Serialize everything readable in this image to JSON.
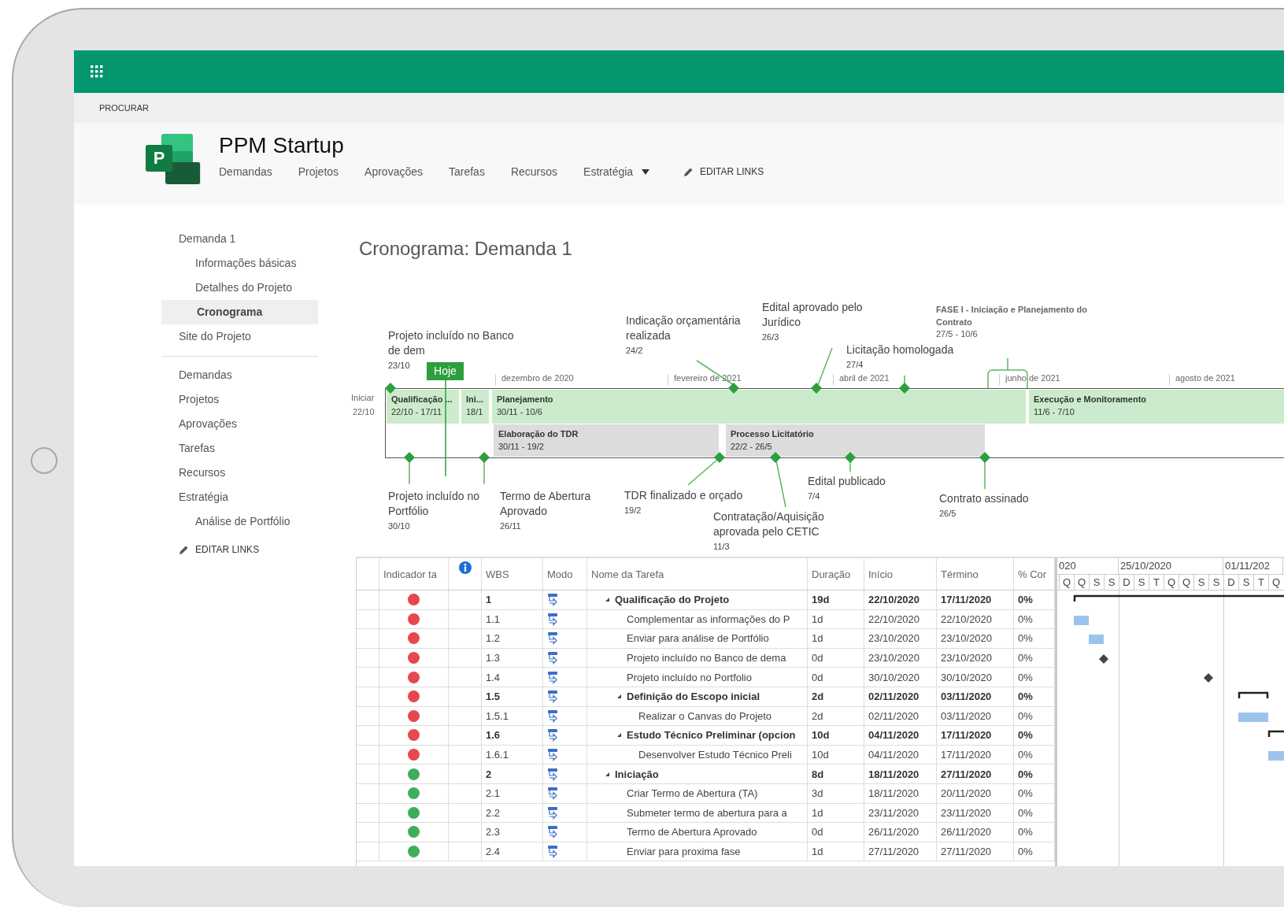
{
  "search_bar": {
    "label": "PROCURAR"
  },
  "site": {
    "logo_letter": "P",
    "title": "PPM Startup",
    "nav": [
      {
        "label": "Demandas",
        "dropdown": false
      },
      {
        "label": "Projetos",
        "dropdown": false
      },
      {
        "label": "Aprovações",
        "dropdown": false
      },
      {
        "label": "Tarefas",
        "dropdown": false
      },
      {
        "label": "Recursos",
        "dropdown": false
      },
      {
        "label": "Estratégia",
        "dropdown": true
      }
    ],
    "edit_links": "EDITAR LINKS"
  },
  "sidebar": {
    "sections": [
      {
        "items": [
          {
            "label": "Demanda 1",
            "selected": false,
            "children": [
              {
                "label": "Informações básicas",
                "selected": false
              },
              {
                "label": "Detalhes do Projeto",
                "selected": false
              },
              {
                "label": "Cronograma",
                "selected": true
              }
            ]
          },
          {
            "label": "Site do Projeto",
            "selected": false
          }
        ]
      },
      {
        "items": [
          {
            "label": "Demandas",
            "selected": false
          },
          {
            "label": "Projetos",
            "selected": false
          },
          {
            "label": "Aprovações",
            "selected": false
          },
          {
            "label": "Tarefas",
            "selected": false
          },
          {
            "label": "Recursos",
            "selected": false
          },
          {
            "label": "Estratégia",
            "selected": false,
            "children": [
              {
                "label": "Análise de Portfólio",
                "selected": false
              }
            ]
          }
        ]
      }
    ],
    "edit_links": "EDITAR LINKS"
  },
  "page_title": "Cronograma: Demanda 1",
  "timeline": {
    "start": {
      "label": "Iniciar",
      "date": "22/10"
    },
    "today": "Hoje",
    "months": [
      "dezembro de 2020",
      "fevereiro de 2021",
      "abril de 2021",
      "junho de 2021",
      "agosto de 2021"
    ],
    "phases": [
      {
        "name": "Qualificação ...",
        "dates": "22/10 - 17/11"
      },
      {
        "name": "Ini...",
        "dates": "18/1"
      },
      {
        "name": "Planejamento",
        "dates": "30/11 - 10/6"
      },
      {
        "name": "Execução e Monitoramento",
        "dates": "11/6 - 7/10"
      }
    ],
    "tasks": [
      {
        "name": "Elaboração do TDR",
        "dates": "30/11 - 19/2"
      },
      {
        "name": "Processo Licitatório",
        "dates": "22/2 - 26/5"
      }
    ],
    "bracket": {
      "label": "FASE I - Iniciação e Planejamento do Contrato",
      "dates": "27/5 - 10/6"
    },
    "milestones_above": [
      {
        "label": "Projeto incluído no Banco de dem",
        "date": "23/10"
      },
      {
        "label": "Indicação orçamentária realizada",
        "date": "24/2"
      },
      {
        "label": "Edital aprovado pelo Jurídico",
        "date": "26/3"
      },
      {
        "label": "Licitação homologada",
        "date": "27/4"
      }
    ],
    "milestones_below": [
      {
        "label": "Projeto incluído no Portfólio",
        "date": "30/10"
      },
      {
        "label": "Termo de Abertura Aprovado",
        "date": "26/11"
      },
      {
        "label": "TDR finalizado e orçado",
        "date": "19/2"
      },
      {
        "label": "Contratação/Aquisição aprovada pelo CETIC",
        "date": "11/3"
      },
      {
        "label": "Edital publicado",
        "date": "7/4"
      },
      {
        "label": "Contrato assinado",
        "date": "26/5"
      }
    ]
  },
  "task_grid": {
    "columns": [
      "Indicador ta",
      "WBS",
      "Modo",
      "Nome da Tarefa",
      "Duração",
      "Início",
      "Término",
      "% Cor"
    ],
    "rows": [
      {
        "color": "#e5484d",
        "wbs": "1",
        "name": "Qualificação do Projeto",
        "duration": "19d",
        "start": "22/10/2020",
        "finish": "17/11/2020",
        "complete": "0%",
        "kind": "summary",
        "expanded": true,
        "children": [
          {
            "color": "#e5484d",
            "wbs": "1.1",
            "name": "Complementar as informações do P",
            "duration": "1d",
            "start": "22/10/2020",
            "finish": "22/10/2020",
            "complete": "0%",
            "kind": "task"
          },
          {
            "color": "#e5484d",
            "wbs": "1.2",
            "name": "Enviar para análise de Portfólio",
            "duration": "1d",
            "start": "23/10/2020",
            "finish": "23/10/2020",
            "complete": "0%",
            "kind": "task"
          },
          {
            "color": "#e5484d",
            "wbs": "1.3",
            "name": "Projeto incluído no Banco de dema",
            "duration": "0d",
            "start": "23/10/2020",
            "finish": "23/10/2020",
            "complete": "0%",
            "kind": "milestone"
          },
          {
            "color": "#e5484d",
            "wbs": "1.4",
            "name": "Projeto incluído no Portfolio",
            "duration": "0d",
            "start": "30/10/2020",
            "finish": "30/10/2020",
            "complete": "0%",
            "kind": "milestone"
          },
          {
            "color": "#e5484d",
            "wbs": "1.5",
            "name": "Definição do Escopo inicial",
            "duration": "2d",
            "start": "02/11/2020",
            "finish": "03/11/2020",
            "complete": "0%",
            "kind": "summary",
            "expanded": true,
            "children": [
              {
                "color": "#e5484d",
                "wbs": "1.5.1",
                "name": "Realizar o Canvas do Projeto",
                "duration": "2d",
                "start": "02/11/2020",
                "finish": "03/11/2020",
                "complete": "0%",
                "kind": "task"
              }
            ]
          },
          {
            "color": "#e5484d",
            "wbs": "1.6",
            "name": "Estudo Técnico Preliminar (opcion",
            "duration": "10d",
            "start": "04/11/2020",
            "finish": "17/11/2020",
            "complete": "0%",
            "kind": "summary",
            "expanded": true,
            "children": [
              {
                "color": "#e5484d",
                "wbs": "1.6.1",
                "name": "Desenvolver Estudo Técnico Preli",
                "duration": "10d",
                "start": "04/11/2020",
                "finish": "17/11/2020",
                "complete": "0%",
                "kind": "task"
              }
            ]
          }
        ]
      },
      {
        "color": "#3fae5a",
        "wbs": "2",
        "name": "Iniciação",
        "duration": "8d",
        "start": "18/11/2020",
        "finish": "27/11/2020",
        "complete": "0%",
        "kind": "summary",
        "expanded": true,
        "children": [
          {
            "color": "#3fae5a",
            "wbs": "2.1",
            "name": "Criar Termo de Abertura (TA)",
            "duration": "3d",
            "start": "18/11/2020",
            "finish": "20/11/2020",
            "complete": "0%",
            "kind": "task"
          },
          {
            "color": "#3fae5a",
            "wbs": "2.2",
            "name": "Submeter termo de abertura para a",
            "duration": "1d",
            "start": "23/11/2020",
            "finish": "23/11/2020",
            "complete": "0%",
            "kind": "task"
          },
          {
            "color": "#3fae5a",
            "wbs": "2.3",
            "name": "Termo de Abertura Aprovado",
            "duration": "0d",
            "start": "26/11/2020",
            "finish": "26/11/2020",
            "complete": "0%",
            "kind": "milestone"
          },
          {
            "color": "#3fae5a",
            "wbs": "2.4",
            "name": "Enviar para proxima fase",
            "duration": "1d",
            "start": "27/11/2020",
            "finish": "27/11/2020",
            "complete": "0%",
            "kind": "task"
          }
        ]
      }
    ]
  },
  "gantt": {
    "weeks": [
      "020",
      "25/10/2020",
      "01/11/202"
    ],
    "days": [
      "Q",
      "Q",
      "S",
      "S",
      "D",
      "S",
      "T",
      "Q",
      "Q",
      "S",
      "S",
      "D",
      "S",
      "T",
      "Q"
    ]
  }
}
